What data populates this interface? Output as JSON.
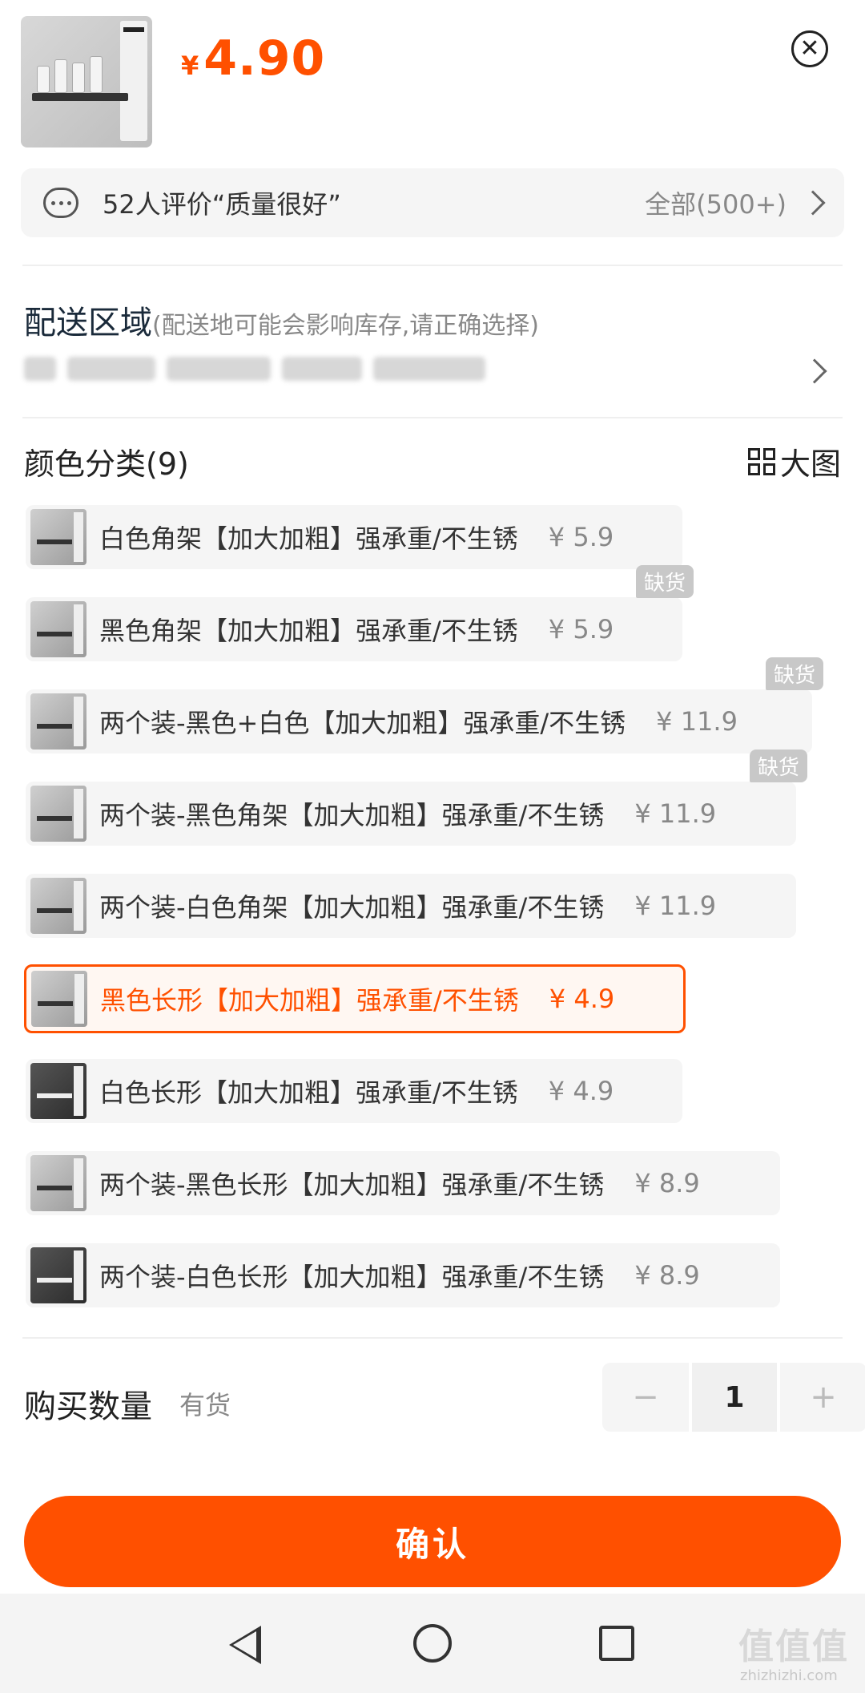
{
  "header": {
    "currency": "¥",
    "price": "4.90",
    "close_icon": "close-circle-icon"
  },
  "reviews": {
    "text": "52人评价“质量很好”",
    "all": "全部(500+)"
  },
  "delivery": {
    "title": "配送区域",
    "hint": "(配送地可能会影响库存,请正确选择)"
  },
  "colors": {
    "title": "颜色分类(9)",
    "big_image": "大图",
    "options": [
      {
        "label": "白色角架【加大加粗】强承重/不生锈",
        "price": "¥ 5.9",
        "badge": ""
      },
      {
        "label": "黑色角架【加大加粗】强承重/不生锈",
        "price": "¥ 5.9",
        "badge": "缺货"
      },
      {
        "label": "两个装-黑色+白色【加大加粗】强承重/不生锈",
        "price": "¥ 11.9",
        "badge": "缺货"
      },
      {
        "label": "两个装-黑色角架【加大加粗】强承重/不生锈",
        "price": "¥ 11.9",
        "badge": "缺货"
      },
      {
        "label": "两个装-白色角架【加大加粗】强承重/不生锈",
        "price": "¥ 11.9",
        "badge": ""
      },
      {
        "label": "黑色长形【加大加粗】强承重/不生锈",
        "price": "¥ 4.9",
        "badge": "",
        "selected": true
      },
      {
        "label": "白色长形【加大加粗】强承重/不生锈",
        "price": "¥ 4.9",
        "badge": ""
      },
      {
        "label": "两个装-黑色长形【加大加粗】强承重/不生锈",
        "price": "¥ 8.9",
        "badge": ""
      },
      {
        "label": "两个装-白色长形【加大加粗】强承重/不生锈",
        "price": "¥ 8.9",
        "badge": ""
      }
    ]
  },
  "quantity": {
    "label": "购买数量",
    "stock": "有货",
    "minus": "−",
    "value": "1",
    "plus": "+"
  },
  "confirm": "确认",
  "watermark": {
    "main": "值值值",
    "sub": "zhizhizhi.com"
  },
  "colors_theme": {
    "accent": "#ff5000",
    "option_bg": "#f5f5f5",
    "badge_bg": "#c8c8c8"
  }
}
